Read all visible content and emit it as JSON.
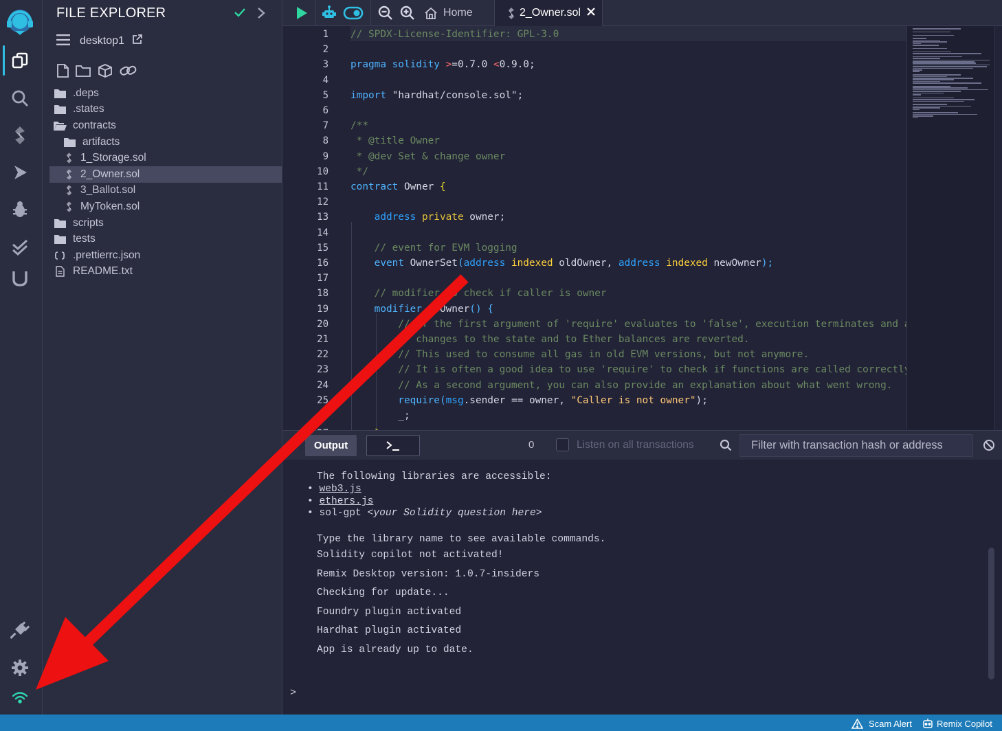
{
  "side_panel": {
    "title": "FILE EXPLORER",
    "workspace": "desktop1",
    "files": [
      {
        "name": ".deps",
        "kind": "folder",
        "depth": 0
      },
      {
        "name": ".states",
        "kind": "folder",
        "depth": 0
      },
      {
        "name": "contracts",
        "kind": "folder-open",
        "depth": 0
      },
      {
        "name": "artifacts",
        "kind": "folder",
        "depth": 1
      },
      {
        "name": "1_Storage.sol",
        "kind": "sol",
        "depth": 1
      },
      {
        "name": "2_Owner.sol",
        "kind": "sol",
        "depth": 1,
        "selected": true
      },
      {
        "name": "3_Ballot.sol",
        "kind": "sol",
        "depth": 1
      },
      {
        "name": "MyToken.sol",
        "kind": "sol",
        "depth": 1
      },
      {
        "name": "scripts",
        "kind": "folder",
        "depth": 0
      },
      {
        "name": "tests",
        "kind": "folder",
        "depth": 0
      },
      {
        "name": ".prettierrc.json",
        "kind": "json",
        "depth": 0
      },
      {
        "name": "README.txt",
        "kind": "txt",
        "depth": 0
      }
    ]
  },
  "topbar": {
    "home_label": "Home",
    "file_tab_label": "2_Owner.sol"
  },
  "editor": {
    "line_numbers": [
      "1",
      "2",
      "3",
      "4",
      "5",
      "6",
      "7",
      "8",
      "9",
      "10",
      "11",
      "12",
      "13",
      "14",
      "15",
      "16",
      "17",
      "18",
      "19",
      "20",
      "21",
      "22",
      "23",
      "24",
      "25"
    ],
    "partial_line_number": "27",
    "lines": [
      [
        {
          "t": "// SPDX-License-Identifier: GPL-3.0",
          "c": "c-com"
        }
      ],
      [],
      [
        {
          "t": "pragma solidity ",
          "c": "c-kw"
        },
        {
          "t": ">",
          "c": "c-op"
        },
        {
          "t": "=0.7.0 ",
          "c": "c-num"
        },
        {
          "t": "<",
          "c": "c-op"
        },
        {
          "t": "0.9.0;",
          "c": "c-num"
        }
      ],
      [],
      [
        {
          "t": "import ",
          "c": "c-kw"
        },
        {
          "t": "\"hardhat/console.sol\";",
          "c": "c-num"
        }
      ],
      [],
      [
        {
          "t": "/**",
          "c": "c-com"
        }
      ],
      [
        {
          "t": " * @title Owner",
          "c": "c-com"
        }
      ],
      [
        {
          "t": " * @dev Set & change owner",
          "c": "c-com"
        }
      ],
      [
        {
          "t": " */",
          "c": "c-com"
        }
      ],
      [
        {
          "t": "contract ",
          "c": "c-kw"
        },
        {
          "t": "Owner ",
          "c": "c-num"
        },
        {
          "t": "{",
          "c": "c-brace"
        }
      ],
      [],
      [
        {
          "t": "    address ",
          "c": "c-typ"
        },
        {
          "t": "private ",
          "c": "c-vis"
        },
        {
          "t": "owner;",
          "c": "c-num"
        }
      ],
      [],
      [
        {
          "t": "    // event for EVM logging",
          "c": "c-com"
        }
      ],
      [
        {
          "t": "    event ",
          "c": "c-kw"
        },
        {
          "t": "OwnerSet",
          "c": "c-num"
        },
        {
          "t": "(",
          "c": "c-fn"
        },
        {
          "t": "address ",
          "c": "c-typ"
        },
        {
          "t": "indexed ",
          "c": "c-idx"
        },
        {
          "t": "oldOwner, ",
          "c": "c-num"
        },
        {
          "t": "address ",
          "c": "c-typ"
        },
        {
          "t": "indexed ",
          "c": "c-idx"
        },
        {
          "t": "newOwner",
          "c": "c-num"
        },
        {
          "t": ");",
          "c": "c-fn"
        }
      ],
      [],
      [
        {
          "t": "    // modifier to check if caller is owner",
          "c": "c-com"
        }
      ],
      [
        {
          "t": "    modifier ",
          "c": "c-kw"
        },
        {
          "t": "isOwner",
          "c": "c-num"
        },
        {
          "t": "() {",
          "c": "c-fn"
        }
      ],
      [
        {
          "t": "        // If the first argument of 'require' evaluates to 'false', execution terminates and all",
          "c": "c-com"
        }
      ],
      [
        {
          "t": "        // changes to the state and to Ether balances are reverted.",
          "c": "c-com"
        }
      ],
      [
        {
          "t": "        // This used to consume all gas in old EVM versions, but not anymore.",
          "c": "c-com"
        }
      ],
      [
        {
          "t": "        // It is often a good idea to use 'require' to check if functions are called correctly.",
          "c": "c-com"
        }
      ],
      [
        {
          "t": "        // As a second argument, you can also provide an explanation about what went wrong.",
          "c": "c-com"
        }
      ],
      [
        {
          "t": "        require",
          "c": "c-fn"
        },
        {
          "t": "(",
          "c": "c-fn"
        },
        {
          "t": "msg",
          "c": "c-typ"
        },
        {
          "t": ".sender == owner, ",
          "c": "c-num"
        },
        {
          "t": "\"Caller is not owner\"",
          "c": "c-str"
        },
        {
          "t": ");",
          "c": "c-num"
        }
      ]
    ],
    "partial_line": "        _;",
    "partial_line_27": "    }"
  },
  "terminal": {
    "output_tab": "Output",
    "pending_count": "0",
    "listen_label": "Listen on all transactions",
    "filter_placeholder": "Filter with transaction hash or address",
    "intro": "The following libraries are accessible:",
    "lib_web3": "web3.js",
    "lib_ethers": "ethers.js",
    "lib_solgpt": "sol-gpt",
    "lib_solgpt_hint": "<your Solidity question here>",
    "lines": [
      "Type the library name to see available commands.",
      "Solidity copilot not activated!",
      "Remix Desktop version: 1.0.7-insiders",
      "Checking for update...",
      "Foundry plugin activated",
      "Hardhat plugin activated",
      "App is already up to date."
    ],
    "prompt": ">"
  },
  "statusbar": {
    "scam_alert": "Scam Alert",
    "copilot": "Remix Copilot"
  },
  "colors": {
    "accent": "#2fbfe3",
    "status_bar": "#1c7bb8",
    "annotation_arrow": "#ee1111"
  }
}
